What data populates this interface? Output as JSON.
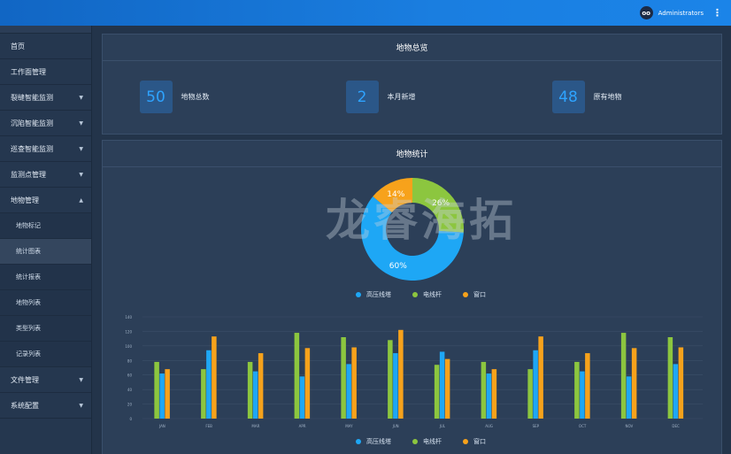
{
  "header": {
    "user_name": "Administrators",
    "avatar_text": "oo"
  },
  "sidebar": {
    "items": [
      {
        "label": "首页"
      },
      {
        "label": "工作面管理"
      },
      {
        "label": "裂缝智能监测"
      },
      {
        "label": "沉陷智能监测"
      },
      {
        "label": "巡查智能监测"
      },
      {
        "label": "监测点管理"
      },
      {
        "label": "地物管理"
      }
    ],
    "sub_items": [
      {
        "label": "地物标记"
      },
      {
        "label": "统计图表"
      },
      {
        "label": "统计报表"
      },
      {
        "label": "地物列表"
      },
      {
        "label": "类型列表"
      },
      {
        "label": "记录列表"
      }
    ],
    "bottom_items": [
      {
        "label": "文件管理"
      },
      {
        "label": "系统配置"
      }
    ],
    "active_sub": "统计图表"
  },
  "overview": {
    "title": "地物总览",
    "stats": [
      {
        "value": "50",
        "label": "地物总数"
      },
      {
        "value": "2",
        "label": "本月新增"
      },
      {
        "value": "48",
        "label": "原有地物"
      }
    ]
  },
  "statistics": {
    "title": "地物统计",
    "watermark": "龙睿海拓"
  },
  "colors": {
    "blue": "#1ea7f5",
    "green": "#8cc63f",
    "orange": "#f7a21b"
  },
  "chart_data": [
    {
      "type": "pie",
      "categories": [
        "高压线塔",
        "电线杆",
        "窗口"
      ],
      "values": [
        60,
        26,
        14
      ],
      "labels": [
        "60%",
        "26%",
        "14%"
      ],
      "colors": [
        "#1ea7f5",
        "#8cc63f",
        "#f7a21b"
      ]
    },
    {
      "type": "bar",
      "categories": [
        "JAN",
        "FEB",
        "MAR",
        "APR",
        "MAY",
        "JUN",
        "JUL",
        "AUG",
        "SEP",
        "OCT",
        "NOV",
        "DEC"
      ],
      "series": [
        {
          "name": "电线杆",
          "values": [
            78,
            68,
            78,
            118,
            112,
            108,
            74,
            78,
            68,
            78,
            118,
            112
          ]
        },
        {
          "name": "高压线塔",
          "values": [
            62,
            94,
            65,
            58,
            75,
            90,
            92,
            62,
            94,
            65,
            58,
            75
          ]
        },
        {
          "name": "窗口",
          "values": [
            68,
            113,
            90,
            97,
            98,
            122,
            82,
            68,
            113,
            90,
            97,
            98
          ]
        }
      ],
      "yticks": [
        "0",
        "20",
        "40",
        "60",
        "80",
        "100",
        "120",
        "140"
      ],
      "ylim": [
        0,
        140
      ],
      "legend": [
        "高压线塔",
        "电线杆",
        "窗口"
      ],
      "grid": true
    }
  ]
}
